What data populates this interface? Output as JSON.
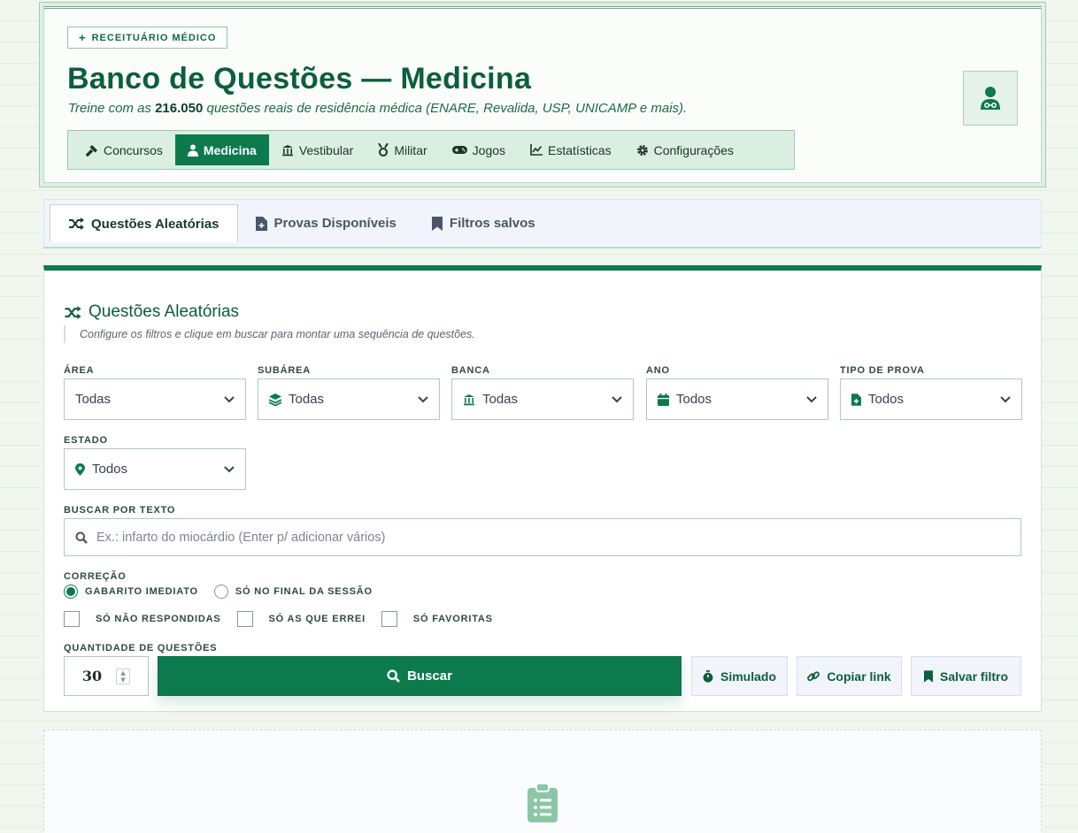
{
  "header": {
    "badge": "RECEITUÁRIO MÉDICO",
    "title": "Banco de Questões — Medicina",
    "subtitle_prefix": "Treine com as ",
    "subtitle_count": "216.050",
    "subtitle_suffix": " questões reais de residência médica (ENARE, Revalida, USP, UNICAMP e mais).",
    "avatar_icon": "user-doctor-icon"
  },
  "nav": {
    "items": [
      {
        "label": "Concursos",
        "icon": "gavel-icon"
      },
      {
        "label": "Medicina",
        "icon": "user-doctor-icon",
        "active": true
      },
      {
        "label": "Vestibular",
        "icon": "building-columns-icon"
      },
      {
        "label": "Militar",
        "icon": "medal-icon"
      },
      {
        "label": "Jogos",
        "icon": "gamepad-icon"
      },
      {
        "label": "Estatísticas",
        "icon": "chart-line-icon"
      },
      {
        "label": "Configurações",
        "icon": "gear-icon"
      }
    ]
  },
  "tabs": [
    {
      "label": "Questões Aleatórias",
      "icon": "shuffle-icon",
      "active": true
    },
    {
      "label": "Provas Disponíveis",
      "icon": "file-medical-icon"
    },
    {
      "label": "Filtros salvos",
      "icon": "bookmark-icon"
    }
  ],
  "panel": {
    "title": "Questões Aleatórias",
    "hint": "Configure os filtros e clique em buscar para montar uma sequência de questões."
  },
  "filters": {
    "area": {
      "label": "ÁREA",
      "value": "Todas"
    },
    "subarea": {
      "label": "SUBÁREA",
      "value": "Todas",
      "icon": "layer-group-icon"
    },
    "banca": {
      "label": "BANCA",
      "value": "Todas",
      "icon": "building-columns-icon"
    },
    "ano": {
      "label": "ANO",
      "value": "Todos",
      "icon": "calendar-icon"
    },
    "tipo": {
      "label": "TIPO DE PROVA",
      "value": "Todos",
      "icon": "file-medical-icon"
    },
    "estado": {
      "label": "ESTADO",
      "value": "Todos",
      "icon": "location-pin-icon"
    }
  },
  "search": {
    "label": "BUSCAR POR TEXTO",
    "placeholder": "Ex.: infarto do miocárdio (Enter p/ adicionar vários)"
  },
  "correcao": {
    "label": "CORREÇÃO",
    "options": [
      "GABARITO IMEDIATO",
      "SÓ NO FINAL DA SESSÃO"
    ],
    "selected": "GABARITO IMEDIATO"
  },
  "checks": [
    "SÓ NÃO RESPONDIDAS",
    "SÓ AS QUE ERREI",
    "SÓ FAVORITAS"
  ],
  "quantity": {
    "label": "QUANTIDADE DE QUESTÕES",
    "value": "30"
  },
  "actions": {
    "buscar": "Buscar",
    "simulado": "Simulado",
    "copiar": "Copiar link",
    "salvar": "Salvar filtro"
  },
  "colors": {
    "accent": "#0d7a4e",
    "accent_dark": "#0b5f3b",
    "tab_bg": "#f1f4fb"
  }
}
